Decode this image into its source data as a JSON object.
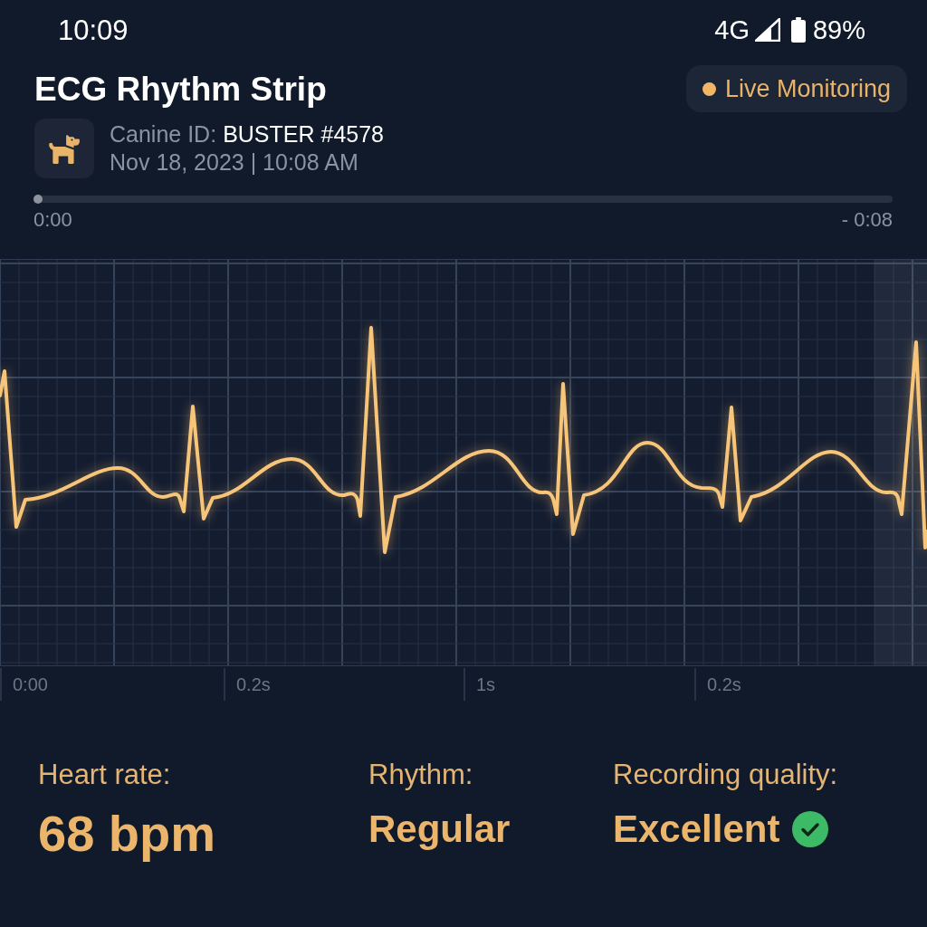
{
  "status_bar": {
    "time": "10:09",
    "network": "4G",
    "battery": "89%"
  },
  "header": {
    "title": "ECG Rhythm Strip",
    "badge": {
      "label": "Live Monitoring"
    },
    "patient": {
      "id_label": "Canine ID:",
      "id_value": "BUSTER #4578",
      "timestamp": "Nov 18, 2023 | 10:08 AM"
    }
  },
  "playback": {
    "level": 0,
    "elapsed": "0:00",
    "remaining": "- 0:08"
  },
  "strip": {
    "time_labels": [
      "0:00",
      "0.2s",
      "1s",
      "0.2s"
    ]
  },
  "stats": [
    {
      "label": "Heart rate:",
      "value": "68 bpm",
      "verified": false
    },
    {
      "label": "Rhythm:",
      "value": "Regular",
      "verified": false
    },
    {
      "label": "Recording quality:",
      "value": "Excellent",
      "verified": true
    }
  ]
}
